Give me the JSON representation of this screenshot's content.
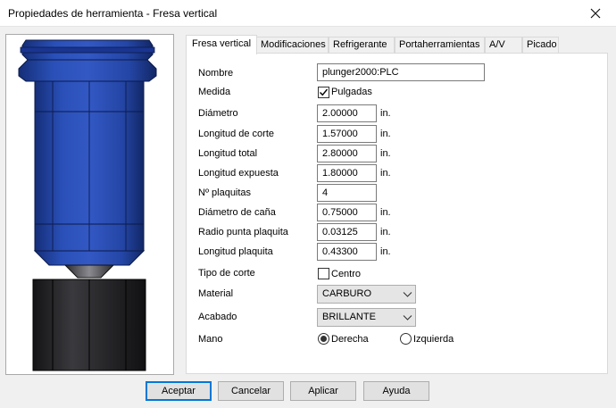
{
  "window": {
    "title": "Propiedades de herramienta - Fresa vertical"
  },
  "tabs": [
    "Fresa vertical",
    "Modificaciones",
    "Refrigerante",
    "Portaherramientas",
    "A/V",
    "Picado"
  ],
  "form": {
    "name": {
      "label": "Nombre",
      "value": "plunger2000:PLC"
    },
    "units": {
      "label": "Medida",
      "checkbox_label": "Pulgadas",
      "checked": true
    },
    "diameter": {
      "label": "Diámetro",
      "value": "2.00000",
      "unit": "in."
    },
    "cut_length": {
      "label": "Longitud de corte",
      "value": "1.57000",
      "unit": "in."
    },
    "total_length": {
      "label": "Longitud total",
      "value": "2.80000",
      "unit": "in."
    },
    "exposed_length": {
      "label": "Longitud expuesta",
      "value": "1.80000",
      "unit": "in."
    },
    "inserts": {
      "label": "Nº plaquitas",
      "value": "4"
    },
    "shank_diameter": {
      "label": "Diámetro de caña",
      "value": "0.75000",
      "unit": "in."
    },
    "corner_radius": {
      "label": "Radio punta plaquita",
      "value": "0.03125",
      "unit": "in."
    },
    "insert_length": {
      "label": "Longitud plaquita",
      "value": "0.43300",
      "unit": "in."
    },
    "cut_type": {
      "label": "Tipo de corte",
      "checkbox_label": "Centro",
      "checked": false
    },
    "material": {
      "label": "Material",
      "value": "CARBURO"
    },
    "finish": {
      "label": "Acabado",
      "value": "BRILLANTE"
    },
    "hand": {
      "label": "Mano",
      "options": [
        "Derecha",
        "Izquierda"
      ],
      "selected": "Derecha"
    }
  },
  "buttons": {
    "accept": "Aceptar",
    "cancel": "Cancelar",
    "apply": "Aplicar",
    "help": "Ayuda"
  },
  "colors": {
    "accent": "#0078d7",
    "tool_blue": "#1f3f9e",
    "tool_dark": "#1f1f22"
  }
}
